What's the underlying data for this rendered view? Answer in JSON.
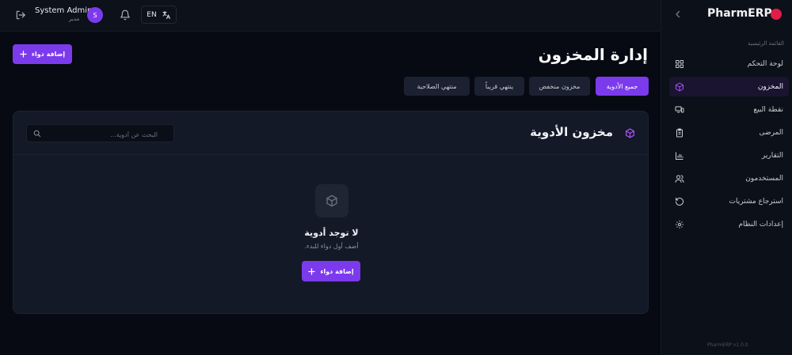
{
  "colors": {
    "accent": "#7c3aed",
    "brand_dot": "#e11d48",
    "background": "#070a12",
    "card": "#131927"
  },
  "header": {
    "user_name": "System Admin",
    "user_role": "مدير",
    "avatar_initial": "S",
    "language_button": "EN",
    "icons": [
      "logout-icon",
      "bell-icon",
      "translate-icon"
    ]
  },
  "sidebar": {
    "brand": "PharmERP",
    "section_title": "القائمة الرئيسية",
    "items": [
      {
        "label": "لوحة التحكم",
        "icon": "dashboard-grid-icon",
        "active": false
      },
      {
        "label": "المخزون",
        "icon": "box-icon",
        "active": true
      },
      {
        "label": "نقطة البيع",
        "icon": "pos-terminal-icon",
        "active": false
      },
      {
        "label": "المرضى",
        "icon": "clipboard-icon",
        "active": false
      },
      {
        "label": "التقارير",
        "icon": "bar-chart-icon",
        "active": false
      },
      {
        "label": "المستخدمون",
        "icon": "users-icon",
        "active": false
      },
      {
        "label": "استرجاع مشتريات",
        "icon": "undo-icon",
        "active": false
      },
      {
        "label": "إعدادات النظام",
        "icon": "gear-icon",
        "active": false
      }
    ],
    "version": "PharmERP v1.0.0"
  },
  "main": {
    "page_title": "إدارة المخزون",
    "add_button": "إضافة دواء",
    "tabs": [
      {
        "label": "جميع الأدوية",
        "active": true
      },
      {
        "label": "مخزون منخفض",
        "active": false
      },
      {
        "label": "ينتهي قريباً",
        "active": false
      },
      {
        "label": "منتهي الصلاحية",
        "active": false
      }
    ],
    "card": {
      "title": "مخزون الأدوية",
      "search_placeholder": "البحث عن أدوية...",
      "empty_title": "لا توجد أدوية",
      "empty_subtitle": "أضف أول دواء للبدء.",
      "empty_button": "إضافة دواء"
    }
  }
}
